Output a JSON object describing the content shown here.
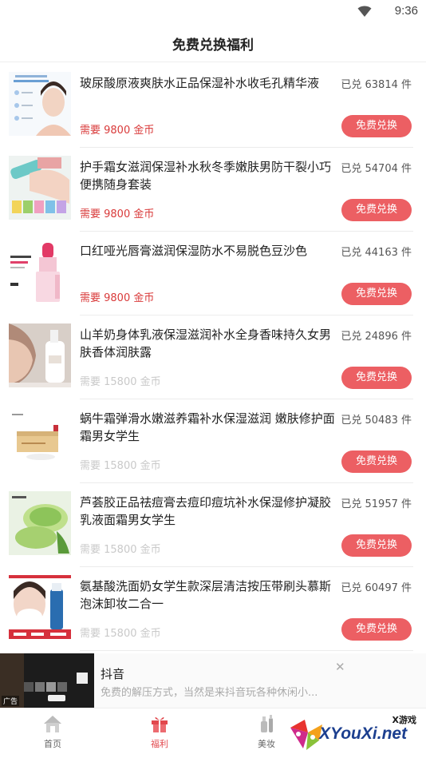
{
  "status_bar": {
    "time": "9:36"
  },
  "header": {
    "title": "免费兑换福利"
  },
  "products": [
    {
      "name": "玻尿酸原液爽肤水正品保湿补水收毛孔精华液",
      "sold": "已兑 63814 件",
      "price": "需要 9800 金币",
      "price_muted": false,
      "button": "免费兑换"
    },
    {
      "name": "护手霜女滋润保湿补水秋冬季嫩肤男防干裂小巧便携随身套装",
      "sold": "已兑 54704 件",
      "price": "需要 9800 金币",
      "price_muted": false,
      "button": "免费兑换"
    },
    {
      "name": "口红哑光唇膏滋润保湿防水不易脱色豆沙色",
      "sold": "已兑 44163 件",
      "price": "需要 9800 金币",
      "price_muted": false,
      "button": "免费兑换"
    },
    {
      "name": "山羊奶身体乳液保湿滋润补水全身香味持久女男肤香体润肤露",
      "sold": "已兑 24896 件",
      "price": "需要 15800 金币",
      "price_muted": true,
      "button": "免费兑换"
    },
    {
      "name": "蜗牛霜弹滑水嫩滋养霜补水保湿滋润 嫩肤修护面霜男女学生",
      "sold": "已兑 50483 件",
      "price": "需要 15800 金币",
      "price_muted": true,
      "button": "免费兑换"
    },
    {
      "name": "芦荟胶正品祛痘膏去痘印痘坑补水保湿修护凝胶乳液面霜男女学生",
      "sold": "已兑 51957 件",
      "price": "需要 15800 金币",
      "price_muted": true,
      "button": "免费兑换"
    },
    {
      "name": "氨基酸洗面奶女学生款深层清洁按压带刷头慕斯泡沫卸妆二合一",
      "sold": "已兑 60497 件",
      "price": "需要 15800 金币",
      "price_muted": true,
      "button": "免费兑换"
    }
  ],
  "ad": {
    "title": "抖音",
    "description": "免费的解压方式，当然是来抖音玩各种休闲小...",
    "label": "广告",
    "close_icon": "close-icon"
  },
  "tabs": [
    {
      "label": "首页",
      "icon": "home-icon",
      "active": false
    },
    {
      "label": "福利",
      "icon": "gift-icon",
      "active": true
    },
    {
      "label": "美妆",
      "icon": "cosmetics-icon",
      "active": false
    }
  ],
  "watermark": {
    "top": "X游戏",
    "main": "XYouXi.net"
  },
  "colors": {
    "accent": "#ec5f63",
    "price_active": "#d93a3a",
    "price_muted": "#c9c9c9",
    "tab_active": "#e2484d"
  }
}
